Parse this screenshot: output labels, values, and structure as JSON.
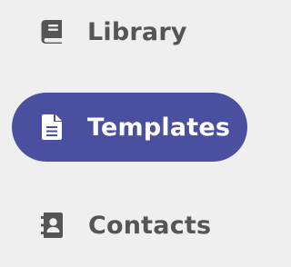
{
  "colors": {
    "background": "#efefef",
    "active_bg": "#4a4fa0",
    "inactive_text": "#555555",
    "active_text": "#ffffff"
  },
  "nav": {
    "items": [
      {
        "label": "Library",
        "icon": "book-icon",
        "active": false
      },
      {
        "label": "Templates",
        "icon": "document-icon",
        "active": true
      },
      {
        "label": "Contacts",
        "icon": "contact-book-icon",
        "active": false
      }
    ]
  }
}
